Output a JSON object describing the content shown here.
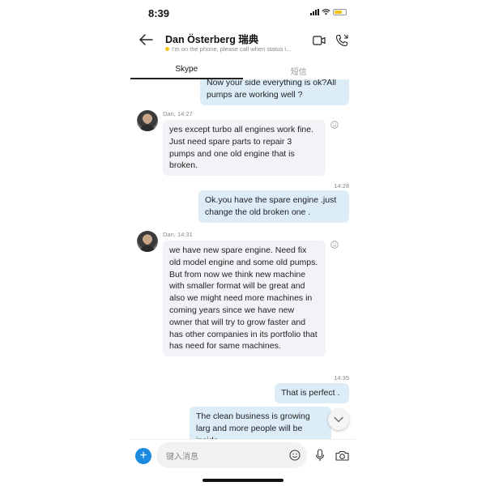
{
  "status_bar": {
    "time": "8:39"
  },
  "header": {
    "contact_name": "Dan Österberg 瑞典",
    "status_message": "I'm on the phone, please call when status i..."
  },
  "tabs": [
    {
      "label": "Skype",
      "active": true
    },
    {
      "label": "短信",
      "active": false
    }
  ],
  "messages": [
    {
      "direction": "out",
      "text": "Now your side everything is ok?All pumps are working well ?"
    },
    {
      "direction": "in",
      "sender": "Dan",
      "time": "14:27",
      "text": "yes except turbo all engines work fine. Just need spare parts to repair 3 pumps and one old engine that is broken."
    },
    {
      "direction": "out",
      "time": "14:28",
      "text": "Ok.you have the spare engine .just change the old broken one ."
    },
    {
      "direction": "in",
      "sender": "Dan",
      "time": "14:31",
      "text": "we have new spare engine. Need fix old model engine and some old pumps. But from now we think new machine with smaller format will be great and also we might need more machines in coming years since we have new owner that will try to grow faster and has other companies in its portfolio that has need for same machines."
    },
    {
      "direction": "out",
      "time": "14:35",
      "text": "That is perfect ."
    },
    {
      "direction": "out",
      "text": "The clean business is growing larg and more people will be inside"
    }
  ],
  "composer": {
    "placeholder": "键入消息"
  },
  "colors": {
    "accent": "#1a8be0",
    "outgoing_bubble": "#dcedf8",
    "incoming_bubble": "#f1f3f6",
    "presence_away": "#f4c20d"
  },
  "icons": [
    "back-arrow-icon",
    "video-call-icon",
    "audio-call-icon",
    "smiley-icon",
    "chevron-down-icon",
    "plus-icon",
    "emoji-icon",
    "microphone-icon",
    "camera-icon"
  ]
}
